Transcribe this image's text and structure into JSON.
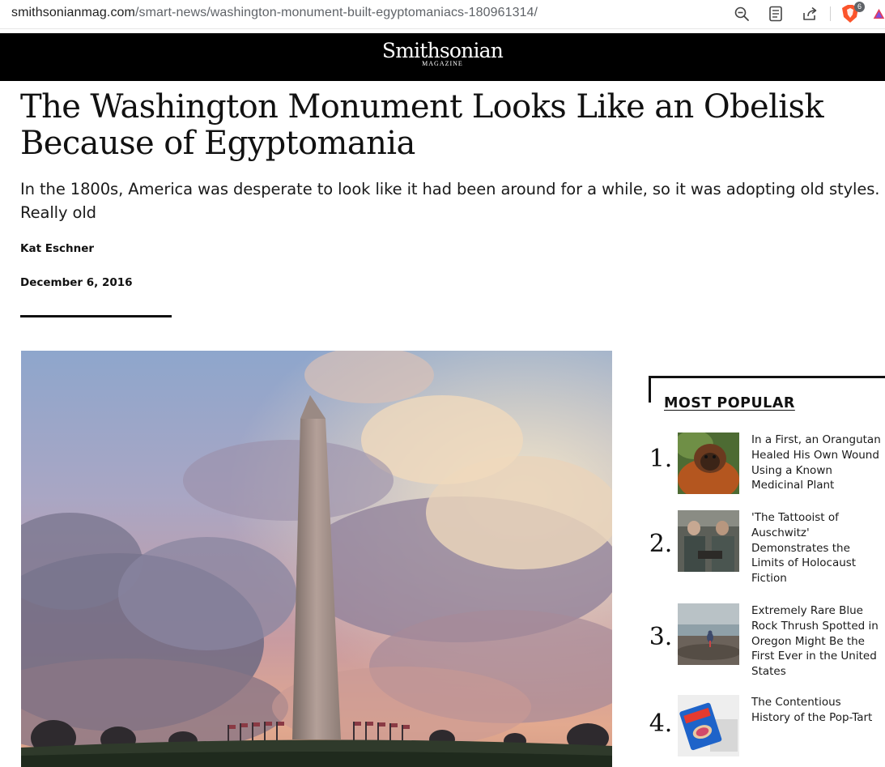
{
  "browser": {
    "url_host": "smithsonianmag.com",
    "url_path": "/smart-news/washington-monument-built-egyptomaniacs-180961314/",
    "toolbar_icons": [
      "zoom-icon",
      "reader-mode-icon",
      "share-icon",
      "brave-shields-icon",
      "brave-rewards-icon"
    ],
    "shields_badge": "6"
  },
  "site": {
    "logo_main": "Smithsonian",
    "logo_sub": "MAGAZINE",
    "header_bg": "#000000"
  },
  "article": {
    "headline": "The Washington Monument Looks Like an Obelisk Because of Egyptomania",
    "dek": "In the 1800s, America was desperate to look like it had been around for a while, so it was adopting old styles. Really old",
    "author": "Kat Eschner",
    "date": "December 6, 2016"
  },
  "most_popular": {
    "title": "MOST POPULAR",
    "items": [
      {
        "rank": "1.",
        "title": "In a First, an Orangutan Healed His Own Wound Using a Known Medicinal Plant"
      },
      {
        "rank": "2.",
        "title": "'The Tattooist of Auschwitz' Demonstrates the Limits of Holocaust Fiction"
      },
      {
        "rank": "3.",
        "title": "Extremely Rare Blue Rock Thrush Spotted in Oregon Might Be the First Ever in the United States"
      },
      {
        "rank": "4.",
        "title": "The Contentious History of the Pop-Tart"
      }
    ]
  }
}
